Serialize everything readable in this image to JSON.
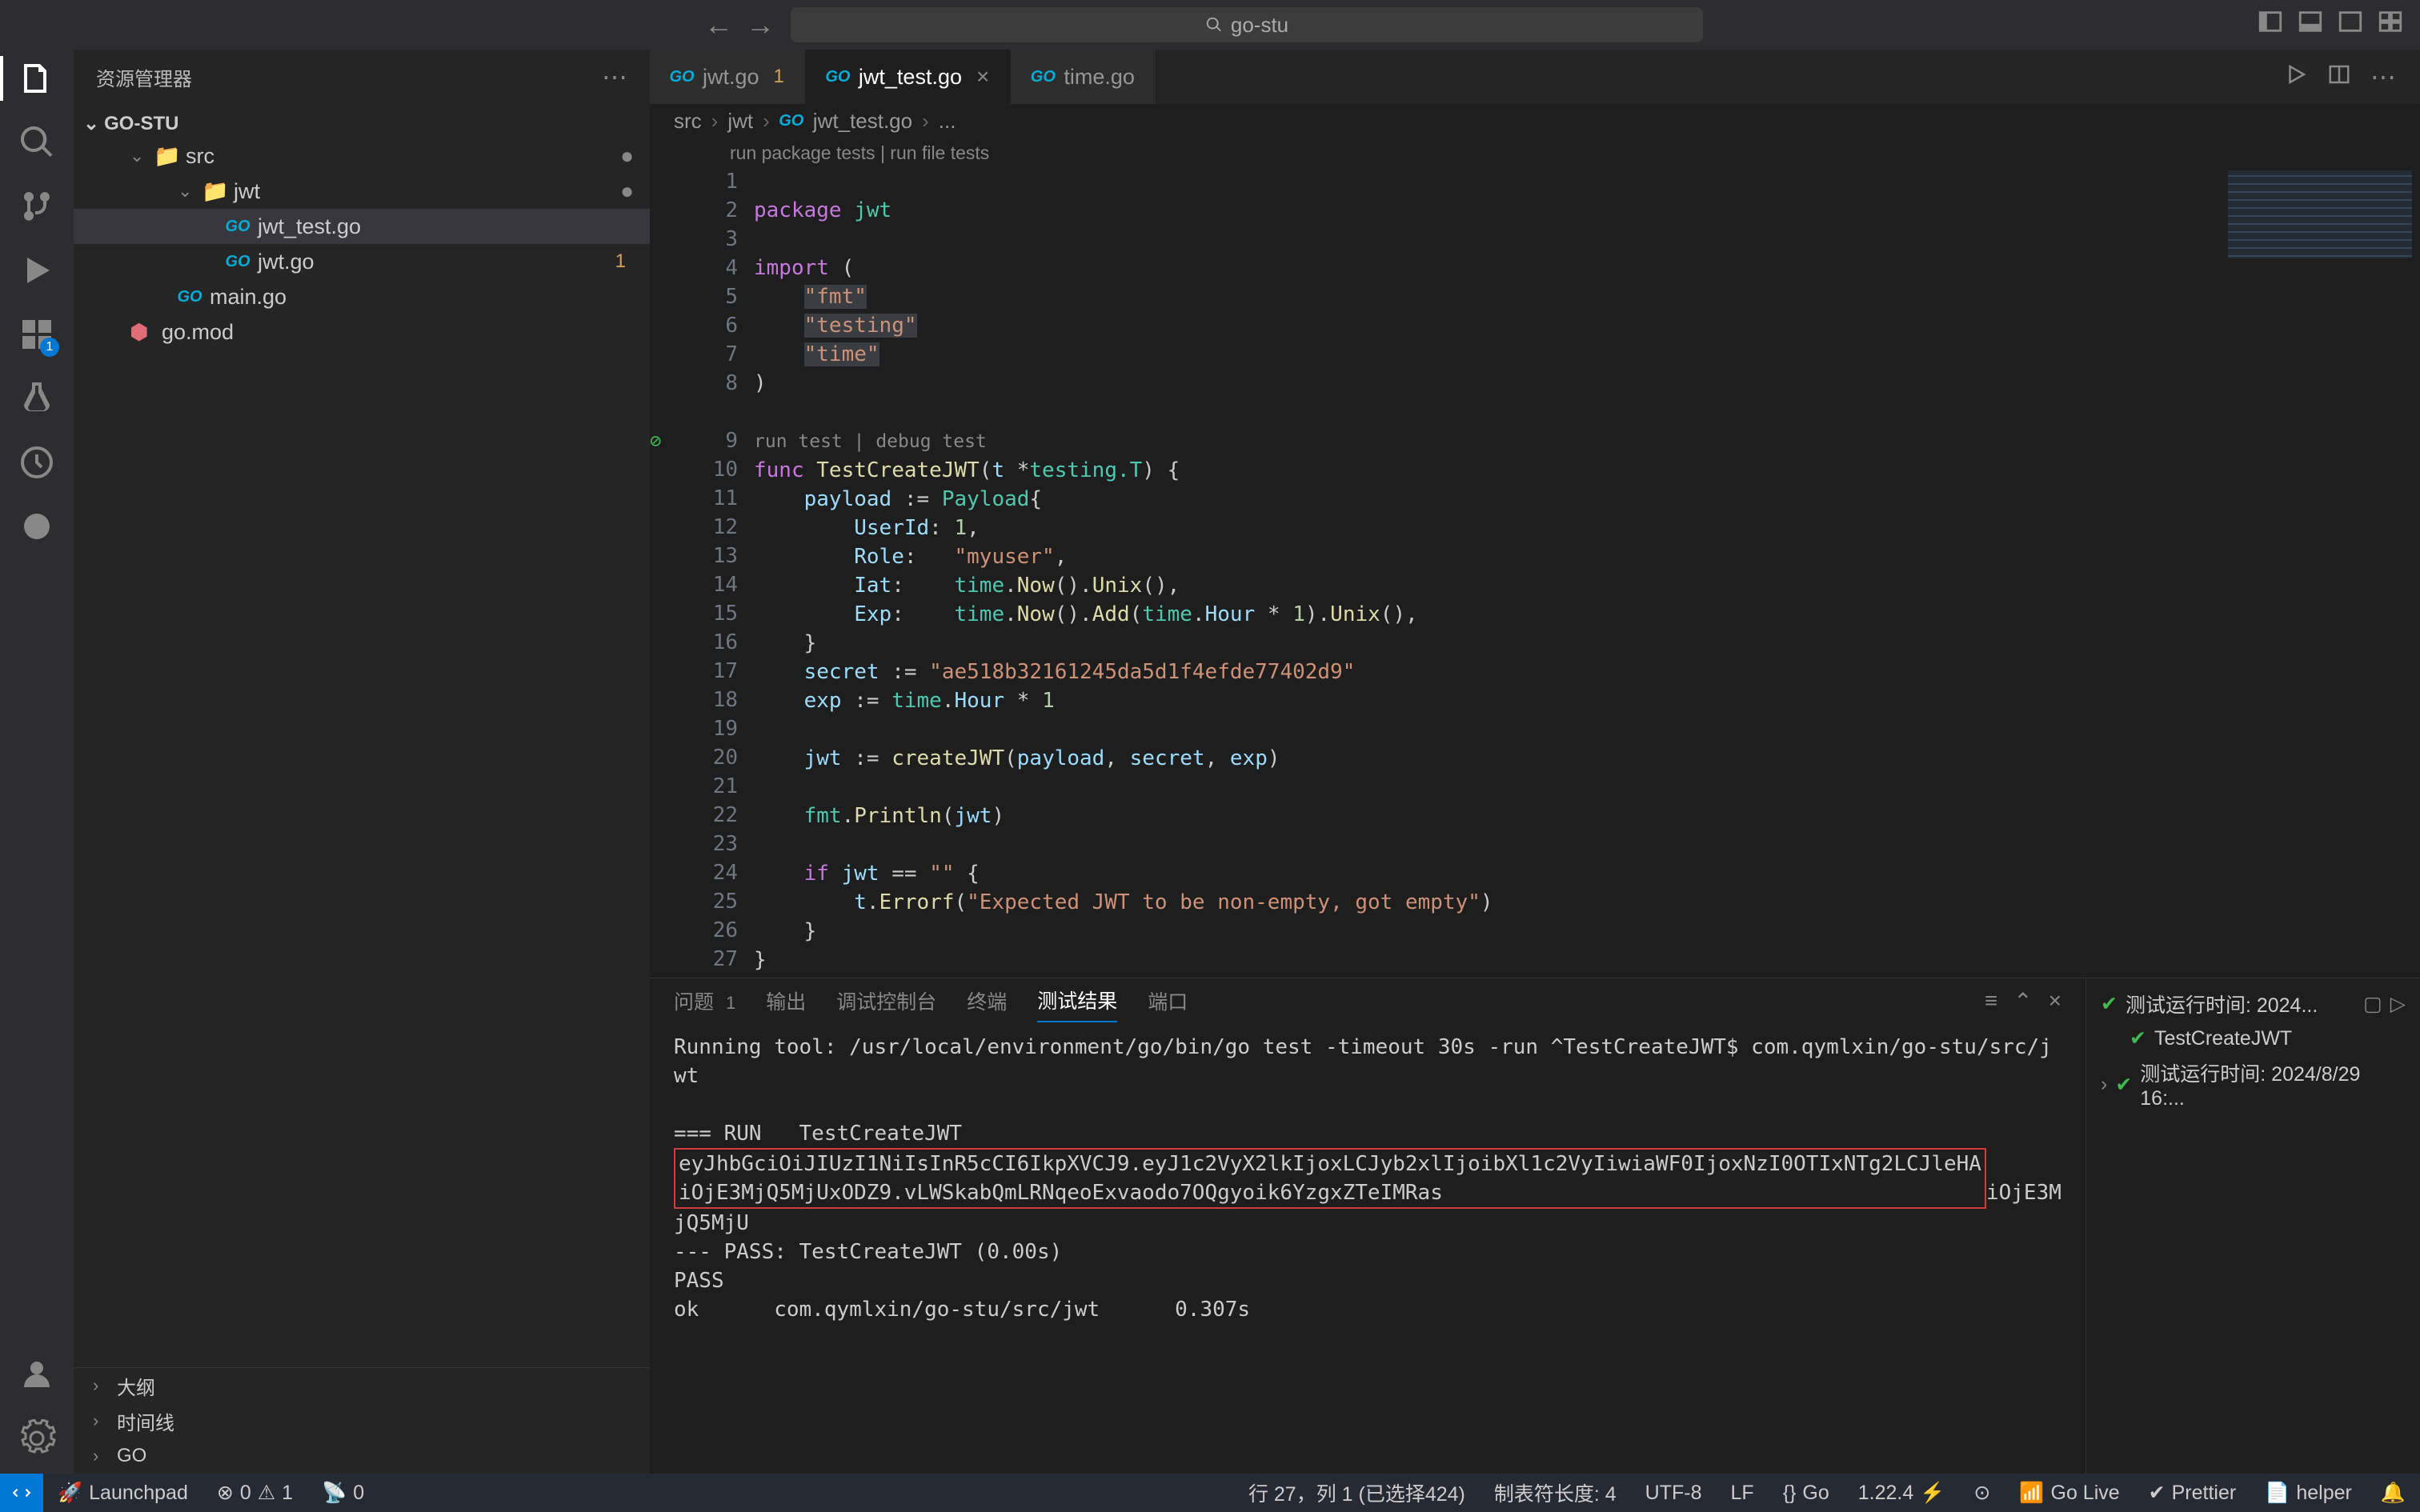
{
  "titlebar": {
    "search_placeholder": "go-stu"
  },
  "sidebar": {
    "title": "资源管理器",
    "project": "GO-STU",
    "tree": {
      "src": "src",
      "jwt": "jwt",
      "jwt_test": "jwt_test.go",
      "jwt_go": "jwt.go",
      "jwt_go_badge": "1",
      "main_go": "main.go",
      "go_mod": "go.mod"
    },
    "bottom": {
      "outline": "大纲",
      "timeline": "时间线",
      "go": "GO"
    }
  },
  "tabs": {
    "t1": "jwt.go",
    "t1_badge": "1",
    "t2": "jwt_test.go",
    "t3": "time.go"
  },
  "breadcrumb": {
    "b1": "src",
    "b2": "jwt",
    "b3": "jwt_test.go",
    "b4": "..."
  },
  "codelens": {
    "l1": "run package tests | run file tests",
    "l2": "run test | debug test"
  },
  "code": {
    "line1_kw": "package",
    "line1_pkg": "jwt",
    "line3_kw": "import",
    "line3_paren": "(",
    "line4": "\"fmt\"",
    "line5": "\"testing\"",
    "line6": "\"time\"",
    "line7": ")",
    "line9_kw": "func",
    "line9_name": "TestCreateJWT",
    "line9_param_t": "t",
    "line9_star": "*",
    "line9_type": "testing.T",
    "line9_brace": ") {",
    "line10_var": "payload",
    "line10_op": ":=",
    "line10_type": "Payload",
    "line10_brace": "{",
    "line11_f": "UserId",
    "line11_v": "1",
    "line12_f": "Role",
    "line12_v": "\"myuser\"",
    "line13_f": "Iat",
    "line13_time": "time",
    "line13_now": "Now",
    "line13_unix": "Unix",
    "line14_f": "Exp",
    "line14_time": "time",
    "line14_now": "Now",
    "line14_add": "Add",
    "line14_hour": "time",
    "line14_hour2": "Hour",
    "line14_mul": "*",
    "line14_n": "1",
    "line14_unix": "Unix",
    "line15_brace": "}",
    "line16_var": "secret",
    "line16_op": ":=",
    "line16_v": "\"ae518b32161245da5d1f4efde77402d9\"",
    "line17_var": "exp",
    "line17_op": ":=",
    "line17_time": "time",
    "line17_hour": "Hour",
    "line17_mul": "*",
    "line17_n": "1",
    "line19_var": "jwt",
    "line19_op": ":=",
    "line19_fn": "createJWT",
    "line19_a1": "payload",
    "line19_a2": "secret",
    "line19_a3": "exp",
    "line21_fmt": "fmt",
    "line21_fn": "Println",
    "line21_arg": "jwt",
    "line23_if": "if",
    "line23_jwt": "jwt",
    "line23_eq": "==",
    "line23_empty": "\"\"",
    "line23_brace": "{",
    "line24_t": "t",
    "line24_fn": "Errorf",
    "line24_msg": "\"Expected JWT to be non-empty, got empty\"",
    "line25_brace": "}",
    "line26_brace": "}"
  },
  "panel": {
    "tabs": {
      "problems": "问题",
      "problems_count": "1",
      "output": "输出",
      "debug_console": "调试控制台",
      "terminal": "终端",
      "test_results": "测试结果",
      "ports": "端口"
    },
    "body": {
      "l1": "Running tool: /usr/local/environment/go/bin/go test -timeout 30s -run ^TestCreateJWT$ com.qymlxin/go-stu/src/jwt",
      "l3": "=== RUN   TestCreateJWT",
      "l4a": "eyJhbGciOiJIUzI1NiIsInR5cCI6IkpXVCJ9.eyJ1c2VyX2lkIjoxLCJyb2xlIjoibXl1c2VyIiwiaWF0IjoxNzI0OTIxNTg2LCJleHA",
      "l4b": "iOjE3MjQ5MjUxODZ9.vLWSkabQmLRNqeoExvaodo7OQgyoik6YzgxZTeIMRas",
      "l4tail": "iOjE3MjQ5MjU",
      "l5": "--- PASS: TestCreateJWT (0.00s)",
      "l6": "PASS",
      "l7": "ok      com.qymlxin/go-stu/src/jwt      0.307s"
    },
    "results": {
      "r1": "测试运行时间: 2024...",
      "r2": "TestCreateJWT",
      "r3": "测试运行时间: 2024/8/29 16:..."
    }
  },
  "statusbar": {
    "launchpad": "Launchpad",
    "errors": "0",
    "warnings": "1",
    "ports": "0",
    "cursor": "行 27，列 1 (已选择424)",
    "tabsize": "制表符长度: 4",
    "encoding": "UTF-8",
    "eol": "LF",
    "lang": "Go",
    "go_ver": "1.22.4",
    "golive": "Go Live",
    "prettier": "Prettier",
    "helper": "helper"
  }
}
